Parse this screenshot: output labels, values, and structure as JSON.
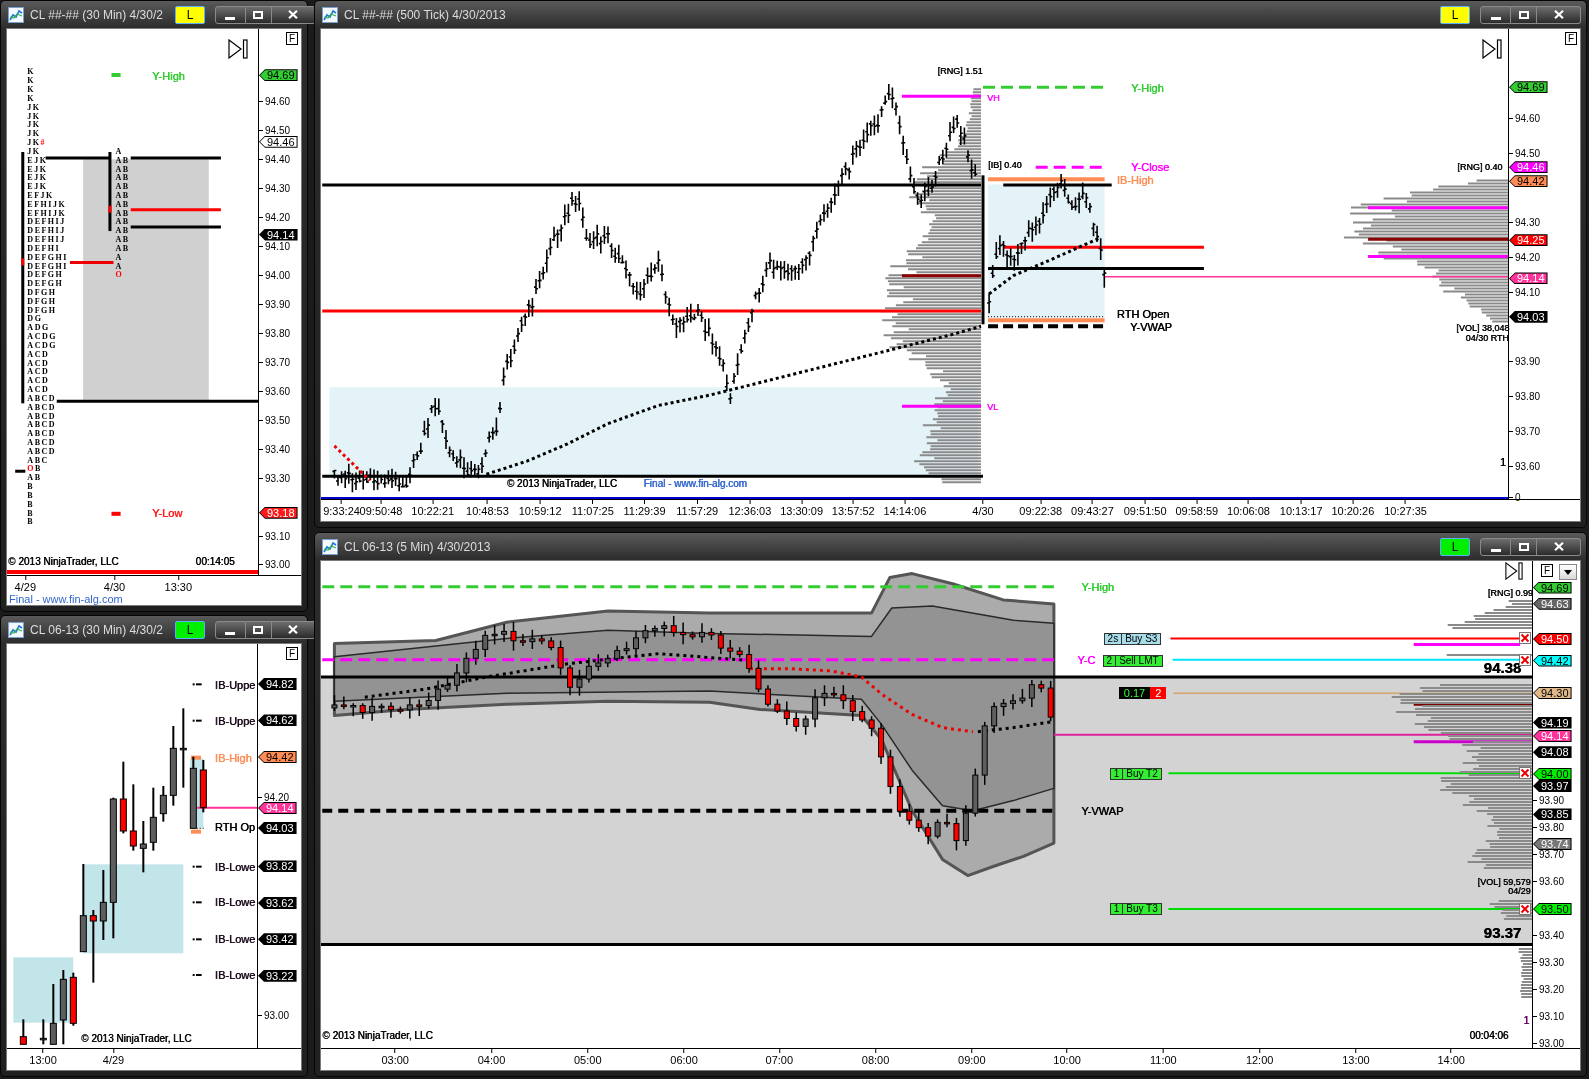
{
  "windows": [
    {
      "kind": "profile",
      "title": "CL ##-## (30 Min) 4/30/2",
      "link": {
        "label": "L",
        "color": "#ffff00"
      },
      "corner_button": "F",
      "skip_icon": true,
      "axis": {
        "ticks": [
          "94.60",
          "94.50",
          "94.40",
          "94.30",
          "94.20",
          "94.10",
          "94.00",
          "93.90",
          "93.80",
          "93.70",
          "93.60",
          "93.50",
          "93.40",
          "93.30",
          "93.10",
          "93.00"
        ],
        "tags": [
          {
            "text": "94.69",
            "color": "#33cc33"
          },
          {
            "text": "94.46",
            "color": "#ffffff"
          },
          {
            "text": "94.14",
            "color": "#000000"
          },
          {
            "text": "93.18",
            "color": "#ff1a1a"
          }
        ]
      },
      "labels": [
        {
          "text": "Y-High",
          "color": "#33cc33"
        },
        {
          "text": "Y-Low",
          "color": "#ff1a1a"
        },
        {
          "text": "© 2013 NinjaTrader, LLC",
          "color": "#000000"
        },
        {
          "text": "00:14:05",
          "color": "#000000"
        }
      ],
      "profiles": [
        [
          {
            "text": "K"
          },
          {
            "text": "K"
          },
          {
            "text": "K"
          },
          {
            "text": "K"
          },
          {
            "text": "JK"
          },
          {
            "text": "JK"
          },
          {
            "text": "JK"
          },
          {
            "text": "JK"
          },
          {
            "text": "JK",
            "tail": "#"
          },
          {
            "text": "JK"
          },
          {
            "text": "EJK"
          },
          {
            "text": "EJK"
          },
          {
            "text": "EJK"
          },
          {
            "text": "EJK"
          },
          {
            "text": "EFJK"
          },
          {
            "text": "EFHIJK"
          },
          {
            "text": "EFHIJK"
          },
          {
            "text": "DEFHIJ"
          },
          {
            "text": "DEFHIJ"
          },
          {
            "text": "DEFHIJ"
          },
          {
            "text": "DEFHI"
          },
          {
            "text": "DEFGHI"
          },
          {
            "text": "DEFGHI"
          },
          {
            "text": "DEFGH"
          },
          {
            "text": "DEFGH"
          },
          {
            "text": "DFGH"
          },
          {
            "text": "DFGH"
          },
          {
            "text": "DFGH"
          },
          {
            "text": "DG"
          },
          {
            "text": "ADG"
          },
          {
            "text": "ACDG"
          },
          {
            "text": "ACDG"
          },
          {
            "text": "ACD"
          },
          {
            "text": "ACD"
          },
          {
            "text": "ACD"
          },
          {
            "text": "ACD"
          },
          {
            "text": "ACD"
          },
          {
            "text": "ABCD"
          },
          {
            "text": "ABCD"
          },
          {
            "text": "ABCD"
          },
          {
            "text": "ABCD"
          },
          {
            "text": "ABCD"
          },
          {
            "text": "ABCD"
          },
          {
            "text": "ABCD"
          },
          {
            "text": "ABC"
          },
          {
            "lead": "O",
            "text": "B"
          },
          {
            "text": "AB"
          },
          {
            "text": "B"
          },
          {
            "text": "B"
          },
          {
            "text": "B"
          },
          {
            "text": "B"
          },
          {
            "text": "B"
          }
        ],
        [
          {
            "text": "A"
          },
          {
            "text": "AB"
          },
          {
            "text": "AB"
          },
          {
            "text": "AB"
          },
          {
            "text": "AB"
          },
          {
            "text": "AB"
          },
          {
            "text": "AB"
          },
          {
            "text": "AB"
          },
          {
            "text": "AB"
          },
          {
            "text": "AB"
          },
          {
            "text": "AB"
          },
          {
            "text": "AB"
          },
          {
            "text": "A"
          },
          {
            "text": "A"
          },
          {
            "lead": "O"
          }
        ]
      ],
      "time_labels": [
        "4/29",
        "4/30",
        "13:30"
      ],
      "footer": "Final - www.fin-alg.com"
    },
    {
      "kind": "ticks",
      "title": "CL ##-## (500 Tick) 4/30/2013",
      "link": {
        "label": "L",
        "color": "#ffff00"
      },
      "corner_button": "F",
      "skip_icon": true,
      "axis": {
        "ticks": [
          "94.60",
          "94.50",
          "94.30",
          "94.20",
          "94.10",
          "93.90",
          "93.80",
          "93.70",
          "93.60"
        ],
        "base_label": "0",
        "tags": [
          {
            "text": "94.69",
            "color": "#33cc33"
          },
          {
            "text": "94.46",
            "color": "#ff00ff"
          },
          {
            "text": "94.42",
            "color": "#ff8c55"
          },
          {
            "text": "94.25",
            "color": "#ff0000"
          },
          {
            "text": "94.14",
            "color": "#ff3399"
          },
          {
            "text": "94.03",
            "color": "#000000"
          }
        ]
      },
      "labels": [
        {
          "text": "[RNG] 1.51",
          "color": "#000000"
        },
        {
          "text": "Y-High",
          "color": "#33cc33"
        },
        {
          "text": "VH",
          "color": "#ff00ff"
        },
        {
          "text": "[IB] 0.40",
          "color": "#000000"
        },
        {
          "text": "Y-Close",
          "color": "#ff00ff"
        },
        {
          "text": "[RNG] 0.40",
          "color": "#000000"
        },
        {
          "text": "IB-High",
          "color": "#ff8c55"
        },
        {
          "text": "RTH Open",
          "color": "#000000"
        },
        {
          "text": "Y-VWAP",
          "color": "#000000"
        },
        {
          "text": "[VOL] 38,048",
          "color": "#000000"
        },
        {
          "text": "04/30 RTH",
          "color": "#000000"
        },
        {
          "text": "VL",
          "color": "#ff00ff"
        },
        {
          "text": "1",
          "color": "#000000"
        },
        {
          "text": "© 2013 NinjaTrader, LLC",
          "color": "#000000"
        },
        {
          "text": "Final - www.fin-alg.com",
          "color": "#3366cc"
        }
      ],
      "time_labels": [
        "9:33:24",
        "09:50:48",
        "10:22:21",
        "10:48:53",
        "10:59:12",
        "11:07:25",
        "11:29:39",
        "11:57:29",
        "12:36:03",
        "13:30:09",
        "13:57:52",
        "14:14:06",
        "4/30",
        "09:22:38",
        "09:43:27",
        "09:51:50",
        "09:58:59",
        "10:06:08",
        "10:13:17",
        "10:20:26",
        "10:27:35"
      ]
    },
    {
      "kind": "candles",
      "title": "CL 06-13 (30 Min) 4/30/2",
      "link": {
        "label": "L",
        "color": "#00ee00"
      },
      "corner_button": "F",
      "axis": {
        "ticks": [
          "94.20",
          "93.00"
        ],
        "tags": [
          {
            "text": "94.82",
            "color": "#000000"
          },
          {
            "text": "94.62",
            "color": "#000000"
          },
          {
            "text": "94.42",
            "color": "#ff8c55"
          },
          {
            "text": "94.14",
            "color": "#ff3399"
          },
          {
            "text": "94.03",
            "color": "#000000"
          },
          {
            "text": "93.82",
            "color": "#000000"
          },
          {
            "text": "93.62",
            "color": "#000000"
          },
          {
            "text": "93.42",
            "color": "#000000"
          },
          {
            "text": "93.22",
            "color": "#000000"
          }
        ]
      },
      "labels": [
        {
          "text": "IB-Uppe",
          "color": "#1a0a1a"
        },
        {
          "text": "IB-Uppe",
          "color": "#1a0a1a"
        },
        {
          "text": "IB-High",
          "color": "#ff8c55"
        },
        {
          "text": "RTH Op",
          "color": "#000000"
        },
        {
          "text": "IB-Lowe",
          "color": "#1a0a1a"
        },
        {
          "text": "IB-Lowe",
          "color": "#1a0a1a"
        },
        {
          "text": "IB-Lowe",
          "color": "#1a0a1a"
        },
        {
          "text": "IB-Lowe",
          "color": "#1a0a1a"
        },
        {
          "text": "© 2013 NinjaTrader, LLC",
          "color": "#000000"
        }
      ],
      "time_labels": [
        "13:00",
        "4/29"
      ]
    },
    {
      "kind": "bands",
      "title": "CL 06-13 (5 Min) 4/30/2013",
      "link": {
        "label": "L",
        "color": "#00ee00"
      },
      "corner_button": "F",
      "skip_icon": true,
      "dropdown": true,
      "axis": {
        "ticks": [
          "93.90",
          "93.80",
          "93.70",
          "93.60",
          "93.40",
          "93.30",
          "93.20",
          "93.10",
          "93.00"
        ],
        "tags": [
          {
            "text": "94.69",
            "color": "#33cc33"
          },
          {
            "text": "94.63",
            "color": "#666666"
          },
          {
            "text": "94.50",
            "color": "#ff0000"
          },
          {
            "text": "94.42",
            "color": "#00ffff"
          },
          {
            "text": "94.30",
            "color": "#e0b88a"
          },
          {
            "text": "94.19",
            "color": "#000000"
          },
          {
            "text": "94.14",
            "color": "#ff3399"
          },
          {
            "text": "94.08",
            "color": "#000000"
          },
          {
            "text": "94.00",
            "color": "#00ee00"
          },
          {
            "text": "93.97",
            "color": "#000000"
          },
          {
            "text": "93.85",
            "color": "#000000"
          },
          {
            "text": "93.74",
            "color": "#777777"
          },
          {
            "text": "93.50",
            "color": "#00ee00"
          }
        ]
      },
      "labels": [
        {
          "text": "Y-High",
          "color": "#33cc33"
        },
        {
          "text": "[RNG] 0.99",
          "color": "#000000"
        },
        {
          "text": "Y-C",
          "color": "#ff00ff"
        },
        {
          "text": "94.38",
          "color": "#000000"
        },
        {
          "text": "Y-VWAP",
          "color": "#000000"
        },
        {
          "text": "[VOL] 59,579",
          "color": "#000000"
        },
        {
          "text": "04/29",
          "color": "#000000"
        },
        {
          "text": "93.37",
          "color": "#000000"
        },
        {
          "text": "1",
          "color": "#660066"
        },
        {
          "text": "© 2013 NinjaTrader, LLC",
          "color": "#000000"
        },
        {
          "text": "00:04:06",
          "color": "#000000"
        }
      ],
      "orders": [
        {
          "qty": "2s",
          "label": "Buy S3",
          "color": "#a8dce8"
        },
        {
          "qty": "2",
          "label": "Sell LMT",
          "color": "#33ee33"
        },
        {
          "qty": "1",
          "label": "Buy T2",
          "color": "#33ee33"
        },
        {
          "qty": "1",
          "label": "Buy T3",
          "color": "#33ee33"
        }
      ],
      "position": {
        "pnl": "0.17",
        "qty": "2"
      },
      "time_labels": [
        "03:00",
        "04:00",
        "05:00",
        "06:00",
        "07:00",
        "08:00",
        "09:00",
        "10:00",
        "11:00",
        "12:00",
        "13:00",
        "14:00"
      ]
    }
  ]
}
